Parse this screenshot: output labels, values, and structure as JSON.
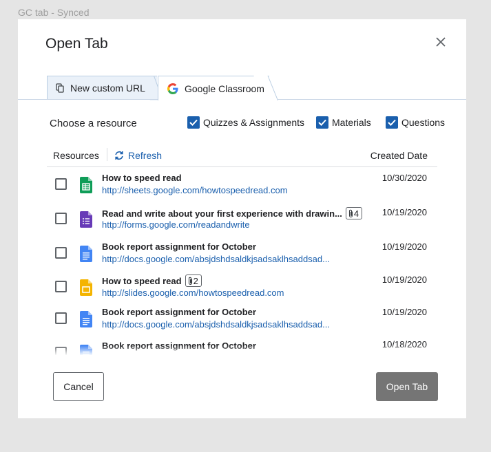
{
  "frame_label": "GC tab - Synced",
  "dialog": {
    "title": "Open Tab",
    "close_icon": "close-icon"
  },
  "tabs": [
    {
      "label": "New custom URL",
      "icon": "link-file-icon",
      "active": false
    },
    {
      "label": "Google Classroom",
      "icon": "google-g-icon",
      "active": true
    }
  ],
  "filters": {
    "label": "Choose a resource",
    "options": [
      {
        "label": "Quizzes & Assignments",
        "checked": true
      },
      {
        "label": "Materials",
        "checked": true
      },
      {
        "label": "Questions",
        "checked": true
      }
    ]
  },
  "list_header": {
    "resources": "Resources",
    "refresh": "Refresh",
    "created_date": "Created Date"
  },
  "rows": [
    {
      "title": "How to speed read",
      "link": "http://sheets.google.com/howtospeedread.com",
      "date": "10/30/2020",
      "icon": "google-sheets-icon",
      "attachments": ""
    },
    {
      "title": "Read and write about your first experience with drawin...",
      "link": "http://forms.google.com/readandwrite",
      "date": "10/19/2020",
      "icon": "google-forms-icon",
      "attachments": "4"
    },
    {
      "title": "Book report assignment for October",
      "link": "http://docs.google.com/absjdshdsaldkjsadsaklhsaddsad...",
      "date": "10/19/2020",
      "icon": "google-docs-icon",
      "attachments": ""
    },
    {
      "title": "How to speed read",
      "link": "http://slides.google.com/howtospeedread.com",
      "date": "10/19/2020",
      "icon": "google-slides-icon",
      "attachments": "2"
    },
    {
      "title": "Book report assignment for October",
      "link": "http://docs.google.com/absjdshdsaldkjsadsaklhsaddsad...",
      "date": "10/19/2020",
      "icon": "google-docs-icon",
      "attachments": ""
    },
    {
      "title": "Book report assignment for October",
      "link": "",
      "date": "10/18/2020",
      "icon": "google-docs-icon",
      "attachments": ""
    }
  ],
  "buttons": {
    "cancel": "Cancel",
    "open": "Open Tab"
  },
  "colors": {
    "accent": "#1a5fad",
    "primary_disabled": "#757575",
    "sheets": "#0f9d58",
    "forms": "#673ab7",
    "docs": "#4285f4",
    "slides": "#f4b400"
  }
}
